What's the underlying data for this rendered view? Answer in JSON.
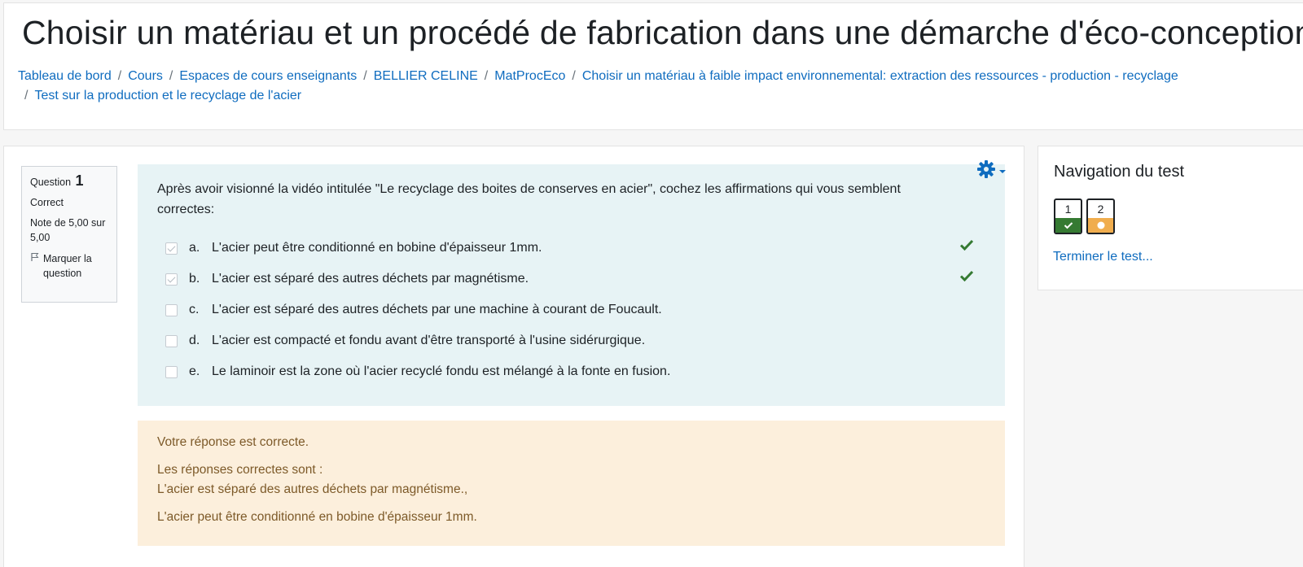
{
  "page": {
    "title": "Choisir un matériau et un procédé de fabrication dans une démarche d'éco-conception"
  },
  "breadcrumb": [
    "Tableau de bord",
    "Cours",
    "Espaces de cours enseignants",
    "BELLIER CELINE",
    "MatProcEco",
    "Choisir un matériau à faible impact environnemental: extraction des ressources - production - recyclage",
    "Test sur la production et le recyclage de l'acier"
  ],
  "question_info": {
    "label": "Question",
    "number": "1",
    "state": "Correct",
    "grade": "Note de 5,00 sur 5,00",
    "flag_label": "Marquer la question",
    "flag_icon": "flag-icon"
  },
  "question": {
    "text": "Après avoir visionné la vidéo intitulée \"Le recyclage des boites de conserves en acier\", cochez les affirmations qui vous semblent correctes:",
    "settings_icon": "gear-icon",
    "answers": [
      {
        "letter": "a.",
        "text": "L'acier peut être conditionné en bobine d'épaisseur 1mm.",
        "checked": true,
        "correct_mark": true
      },
      {
        "letter": "b.",
        "text": "L'acier est séparé des autres déchets par magnétisme.",
        "checked": true,
        "correct_mark": true
      },
      {
        "letter": "c.",
        "text": "L'acier est séparé des autres déchets par une machine à courant de Foucault.",
        "checked": false,
        "correct_mark": false
      },
      {
        "letter": "d.",
        "text": "L'acier est compacté et fondu avant d'être transporté à l'usine sidérurgique.",
        "checked": false,
        "correct_mark": false
      },
      {
        "letter": "e.",
        "text": "Le laminoir est la zone où l'acier recyclé fondu est mélangé à la fonte en fusion.",
        "checked": false,
        "correct_mark": false
      }
    ]
  },
  "feedback": {
    "result": "Votre réponse est correcte.",
    "right_answer_heading": "Les réponses correctes sont :",
    "right_answer_1": "L'acier est séparé des autres déchets par magnétisme.,",
    "right_answer_2": "L'acier peut être conditionné en bobine d'épaisseur 1mm."
  },
  "navigation": {
    "title": "Navigation du test",
    "buttons": [
      {
        "number": "1",
        "state": "correct"
      },
      {
        "number": "2",
        "state": "partial"
      }
    ],
    "finish_link": "Terminer le test..."
  },
  "colors": {
    "link": "#0f6cbf",
    "correct": "#357a32",
    "partial": "#f0ad4e",
    "formulation_bg": "#e7f3f5",
    "outcome_bg": "#fcefdc",
    "outcome_text": "#7d5a29"
  }
}
